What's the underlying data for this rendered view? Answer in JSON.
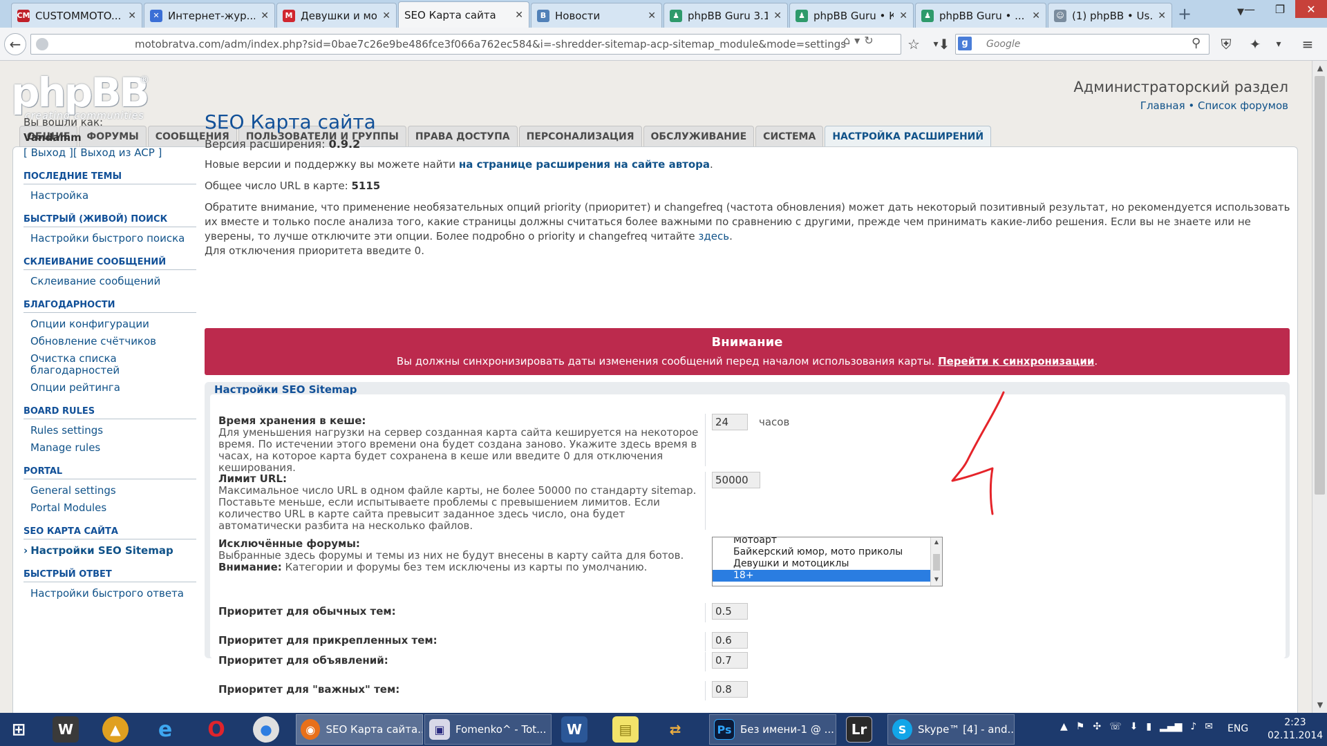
{
  "browser": {
    "tabs": [
      {
        "label": "CUSTOMMOTO...",
        "favicon_text": "CM",
        "favicon_color": "#c0202a"
      },
      {
        "label": "Интернет-жур...",
        "favicon_text": "✕",
        "favicon_color": "#3b6fd6"
      },
      {
        "label": "Девушки и мо...",
        "favicon_text": "M",
        "favicon_color": "#d0262f"
      },
      {
        "label": "SEO Карта сайта",
        "favicon_text": "",
        "favicon_color": "#f5f6f7"
      },
      {
        "label": "Новости",
        "favicon_text": "В",
        "favicon_color": "#5181b8"
      },
      {
        "label": "phpBB Guru 3.1...",
        "favicon_text": "♟",
        "favicon_color": "#2e9a6b"
      },
      {
        "label": "phpBB Guru • К...",
        "favicon_text": "♟",
        "favicon_color": "#2e9a6b"
      },
      {
        "label": "phpBB Guru • ...",
        "favicon_text": "♟",
        "favicon_color": "#2e9a6b"
      },
      {
        "label": "(1) phpBB • Us...",
        "favicon_text": "☺",
        "favicon_color": "#7a8c9e"
      }
    ],
    "url": "motobratva.com/adm/index.php?sid=0bae7c26e9be486fce3f066a762ec584&i=-shredder-sitemap-acp-sitemap_module&mode=settings",
    "search_placeholder": "Google",
    "search_engine_letter": "g"
  },
  "header": {
    "logo_text": "phpBB",
    "logo_reg": "®",
    "logo_tagline": "creating communities",
    "admin_title": "Администраторский раздел",
    "link_home": "Главная",
    "link_sep": " • ",
    "link_forums": "Список форумов"
  },
  "main_tabs": [
    {
      "label": "ОБЩИЕ",
      "active": false
    },
    {
      "label": "ФОРУМЫ",
      "active": false
    },
    {
      "label": "СООБЩЕНИЯ",
      "active": false
    },
    {
      "label": "ПОЛЬЗОВАТЕЛИ И ГРУППЫ",
      "active": false
    },
    {
      "label": "ПРАВА ДОСТУПА",
      "active": false
    },
    {
      "label": "ПЕРСОНАЛИЗАЦИЯ",
      "active": false
    },
    {
      "label": "ОБСЛУЖИВАНИЕ",
      "active": false
    },
    {
      "label": "СИСТЕМА",
      "active": false
    },
    {
      "label": "НАСТРОЙКА РАСШИРЕНИЙ",
      "active": true
    }
  ],
  "sidebar": {
    "login_label": "Вы вошли как:",
    "username": "Vandamm",
    "logout": "[ Выход ]",
    "logout_acp": "[ Выход из ACP ]",
    "sections": [
      {
        "title": "ПОСЛЕДНИЕ ТЕМЫ",
        "items": [
          {
            "label": "Настройка",
            "active": false
          }
        ]
      },
      {
        "title": "БЫСТРЫЙ (ЖИВОЙ) ПОИСК",
        "items": [
          {
            "label": "Настройки быстрого поиска",
            "active": false
          }
        ]
      },
      {
        "title": "СКЛЕИВАНИЕ СООБЩЕНИЙ",
        "items": [
          {
            "label": "Склеивание сообщений",
            "active": false
          }
        ]
      },
      {
        "title": "БЛАГОДАРНОСТИ",
        "items": [
          {
            "label": "Опции конфигурации",
            "active": false
          },
          {
            "label": "Обновление счётчиков",
            "active": false
          },
          {
            "label": "Очистка списка благодарностей",
            "active": false
          },
          {
            "label": "Опции рейтинга",
            "active": false
          }
        ]
      },
      {
        "title": "BOARD RULES",
        "items": [
          {
            "label": "Rules settings",
            "active": false
          },
          {
            "label": "Manage rules",
            "active": false
          }
        ]
      },
      {
        "title": "PORTAL",
        "items": [
          {
            "label": "General settings",
            "active": false
          },
          {
            "label": "Portal Modules",
            "active": false
          }
        ]
      },
      {
        "title": "SEO КАРТА САЙТА",
        "items": [
          {
            "label": "Настройки SEO Sitemap",
            "active": true
          }
        ]
      },
      {
        "title": "БЫСТРЫЙ ОТВЕТ",
        "items": [
          {
            "label": "Настройки быстрого ответа",
            "active": false
          }
        ]
      }
    ]
  },
  "main": {
    "title": "SEO Карта сайта",
    "version_label": "Версия расширения: ",
    "version": "0.9.2",
    "support_text": "Новые версии и поддержку вы можете найти ",
    "support_link": "на странице расширения на сайте автора",
    "support_end": ".",
    "url_count_label": "Общее число URL в карте: ",
    "url_count": "5115",
    "notice_text": "Обратите внимание, что применение необязательных опций priority (приоритет) и changefreq (частота обновления) может дать некоторый позитивный результат, но рекомендуется использовать их вместе и только после анализа того, какие страницы должны считаться более важными по сравнению с другими, прежде чем принимать какие-либо решения. Если вы не знаете или не уверены, то лучше отключите эти опции. Более подробно о priority и changefreq читайте ",
    "notice_link": "здесь",
    "notice_end": ".",
    "priority_disable": "Для отключения приоритета введите 0."
  },
  "warning": {
    "title": "Внимание",
    "text": "Вы должны синхронизировать даты изменения сообщений перед началом использования карты. ",
    "link": "Перейти к синхронизации",
    "end": "."
  },
  "settings": {
    "legend": "Настройки SEO Sitemap",
    "cache_title": "Время хранения в кеше:",
    "cache_desc": "Для уменьшения нагрузки на сервер созданная карта сайта кешируется на некоторое время. По истечении этого времени она будет создана заново. Укажите здесь время в часах, на которое карта будет сохранена в кеше или введите 0 для отключения кеширования.",
    "cache_value": "24",
    "cache_unit": "часов",
    "url_limit_title": "Лимит URL:",
    "url_limit_desc": "Максимальное число URL в одном файле карты, не более 50000 по стандарту sitemap. Поставьте меньше, если испытываете проблемы с превышением лимитов. Если количество URL в карте сайта превысит заданное здесь число, она будет автоматически разбита на несколько файлов.",
    "url_limit_value": "50000",
    "excluded_title": "Исключённые форумы:",
    "excluded_desc": "Выбранные здесь форумы и темы из них не будут внесены в карту сайта для ботов.",
    "excluded_warn_label": "Внимание:",
    "excluded_warn": " Категории и форумы без тем исключены из карты по умолчанию.",
    "forums": [
      {
        "label": "Мотоарт",
        "selected": false
      },
      {
        "label": "Байкерский юмор, мото приколы",
        "selected": false
      },
      {
        "label": "Девушки и мотоциклы",
        "selected": false
      },
      {
        "label": "18+",
        "selected": true
      }
    ],
    "prio_normal_title": "Приоритет для обычных тем:",
    "prio_normal_value": "0.5",
    "prio_sticky_title": "Приоритет для прикрепленных тем:",
    "prio_sticky_value": "0.6",
    "prio_announce_title": "Приоритет для объявлений:",
    "prio_announce_value": "0.7",
    "prio_global_title": "Приоритет для \"важных\" тем:",
    "prio_global_value": "0.8"
  },
  "taskbar": {
    "apps": [
      {
        "label": "SEO Карта сайта...",
        "icon": "firefox-icon",
        "active": true
      },
      {
        "label": "Fomenko^ - Tot...",
        "icon": "totalcmd-icon",
        "active": false
      },
      {
        "label": "Без имени-1 @ ...",
        "icon": "photoshop-icon",
        "active": false
      },
      {
        "label": "Skype™ [4] - and...",
        "icon": "skype-icon",
        "active": false
      }
    ],
    "lang": "ENG",
    "time": "2:23",
    "date": "02.11.2014"
  },
  "colors": {
    "accent_blue": "#105289",
    "warning_red": "#bc2a4d",
    "taskbar": "#1d3a6d",
    "annotation_red": "#e5242a"
  }
}
